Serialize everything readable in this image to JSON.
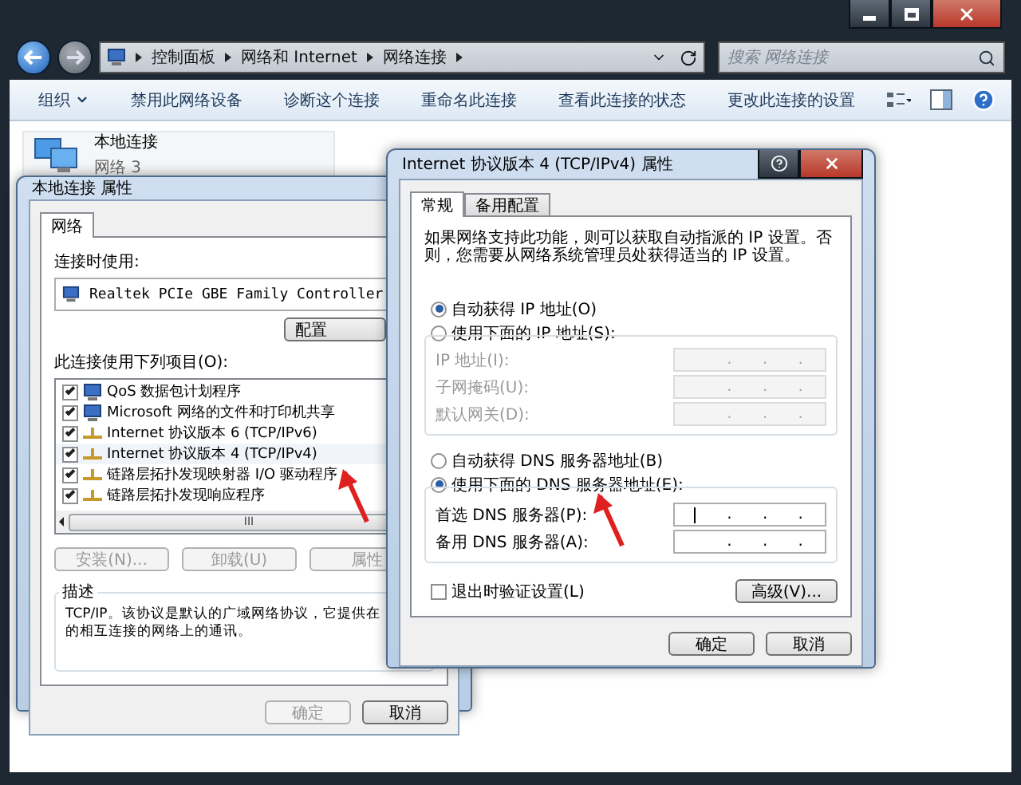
{
  "explorer": {
    "breadcrumb": [
      "控制面板",
      "网络和 Internet",
      "网络连接"
    ],
    "search": {
      "placeholder": "搜索 网络连接"
    },
    "toolbar": [
      {
        "label": "组织",
        "dropdown": true
      },
      {
        "label": "禁用此网络设备",
        "dropdown": false
      },
      {
        "label": "诊断这个连接",
        "dropdown": false
      },
      {
        "label": "重命名此连接",
        "dropdown": false
      },
      {
        "label": "查看此连接的状态",
        "dropdown": false
      },
      {
        "label": "更改此连接的设置",
        "dropdown": false
      }
    ],
    "connection": {
      "name": "本地连接",
      "network": "网络 3"
    }
  },
  "local_dialog": {
    "title": "本地连接 属性",
    "tabs": [
      {
        "label": "网络",
        "selected": true
      }
    ],
    "connect_using_label": "连接时使用:",
    "adapter": "Realtek PCIe GBE Family Controller",
    "configure_button": "配置",
    "items_label": "此连接使用下列项目(O):",
    "items": [
      {
        "label": "QoS 数据包计划程序",
        "checked": true,
        "kind": "client",
        "selected": false
      },
      {
        "label": "Microsoft 网络的文件和打印机共享",
        "checked": true,
        "kind": "client",
        "selected": false
      },
      {
        "label": "Internet 协议版本 6 (TCP/IPv6)",
        "checked": true,
        "kind": "protocol",
        "selected": false
      },
      {
        "label": "Internet 协议版本 4 (TCP/IPv4)",
        "checked": true,
        "kind": "protocol",
        "selected": true
      },
      {
        "label": "链路层拓扑发现映射器 I/O 驱动程序",
        "checked": true,
        "kind": "protocol",
        "selected": false
      },
      {
        "label": "链路层拓扑发现响应程序",
        "checked": true,
        "kind": "protocol",
        "selected": false
      }
    ],
    "scrollbar_grip": "III",
    "buttons": [
      {
        "label": "安装(N)...",
        "disabled": true
      },
      {
        "label": "卸载(U)",
        "disabled": true
      },
      {
        "label": "属性",
        "disabled": true
      }
    ],
    "description": {
      "title": "描述",
      "lines": [
        "TCP/IP。该协议是默认的广域网络协议，它提供在",
        "的相互连接的网络上的通讯。"
      ]
    },
    "footer_buttons": [
      {
        "label": "确定",
        "disabled": true
      },
      {
        "label": "取消",
        "disabled": false
      }
    ]
  },
  "ipv4_dialog": {
    "title": "Internet 协议版本 4 (TCP/IPv4) 属性",
    "tabs": [
      {
        "label": "常规",
        "selected": true
      },
      {
        "label": "备用配置",
        "selected": false
      }
    ],
    "intro": "如果网络支持此功能，则可以获取自动指派的 IP 设置。否则，您需要从网络系统管理员处获得适当的 IP 设置。",
    "ip_options": [
      {
        "label": "自动获得 IP 地址(O)",
        "selected": true
      },
      {
        "label": "使用下面的 IP 地址(S):",
        "selected": false
      }
    ],
    "ip_fields": [
      {
        "label": "IP 地址(I):",
        "disabled": true,
        "cursor": false,
        "dots": [
          ".",
          ".",
          "."
        ]
      },
      {
        "label": "子网掩码(U):",
        "disabled": true,
        "cursor": false,
        "dots": [
          ".",
          ".",
          "."
        ]
      },
      {
        "label": "默认网关(D):",
        "disabled": true,
        "cursor": false,
        "dots": [
          ".",
          ".",
          "."
        ]
      }
    ],
    "dns_options": [
      {
        "label": "自动获得 DNS 服务器地址(B)",
        "selected": false
      },
      {
        "label": "使用下面的 DNS 服务器地址(E):",
        "selected": true
      }
    ],
    "dns_fields": [
      {
        "label": "首选 DNS 服务器(P):",
        "disabled": false,
        "cursor": true,
        "dots": [
          ".",
          ".",
          "."
        ]
      },
      {
        "label": "备用 DNS 服务器(A):",
        "disabled": false,
        "cursor": false,
        "dots": [
          ".",
          ".",
          "."
        ]
      }
    ],
    "validate": {
      "label": "退出时验证设置(L)",
      "checked": false
    },
    "advanced_button": "高级(V)...",
    "footer_buttons": [
      {
        "label": "确定",
        "disabled": false
      },
      {
        "label": "取消",
        "disabled": false
      }
    ]
  }
}
